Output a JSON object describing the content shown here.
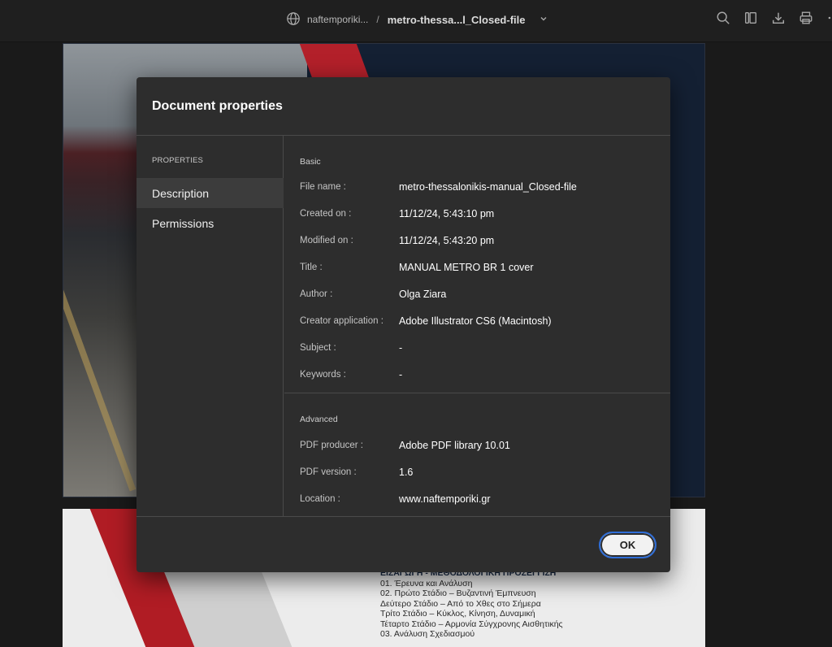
{
  "topbar": {
    "site": "naftemporiki...",
    "separator": "/",
    "file": "metro-thessa...l_Closed-file"
  },
  "background": {
    "toc": {
      "heading": "ΕΙΣΑΓΩΓΗ - ΜΕΘΟΔΟΛΟΓΙΚΗ ΠΡΟΣΕΓΓΙΣΗ",
      "lines": [
        "01. Έρευνα και Ανάλυση",
        "02. Πρώτο Στάδιο – Βυζαντινή Έμπνευση",
        "Δεύτερο Στάδιο – Από το Χθες στο Σήμερα",
        "Τρίτο Στάδιο – Κύκλος, Κίνηση, Δυναμική",
        "Τέταρτο Στάδιο – Αρμονία Σύγχρονης Αισθητικής",
        "03. Ανάλυση Σχεδιασμού"
      ]
    }
  },
  "dialog": {
    "title": "Document properties",
    "sidebar": {
      "heading": "PROPERTIES",
      "items": [
        {
          "label": "Description",
          "active": true
        },
        {
          "label": "Permissions",
          "active": false
        }
      ]
    },
    "basic": {
      "label": "Basic",
      "rows": [
        {
          "key": "File name :",
          "value": "metro-thessalonikis-manual_Closed-file"
        },
        {
          "key": "Created on :",
          "value": "11/12/24, 5:43:10 pm"
        },
        {
          "key": "Modified on :",
          "value": "11/12/24, 5:43:20 pm"
        },
        {
          "key": "Title :",
          "value": "MANUAL METRO BR 1 cover"
        },
        {
          "key": "Author :",
          "value": "Olga Ziara"
        },
        {
          "key": "Creator application :",
          "value": "Adobe Illustrator CS6 (Macintosh)"
        },
        {
          "key": "Subject :",
          "value": "-"
        },
        {
          "key": "Keywords :",
          "value": "-"
        }
      ]
    },
    "advanced": {
      "label": "Advanced",
      "rows": [
        {
          "key": "PDF producer :",
          "value": "Adobe PDF library 10.01"
        },
        {
          "key": "PDF version :",
          "value": "1.6"
        },
        {
          "key": "Location :",
          "value": "www.naftemporiki.gr"
        }
      ]
    },
    "ok_label": "OK"
  }
}
